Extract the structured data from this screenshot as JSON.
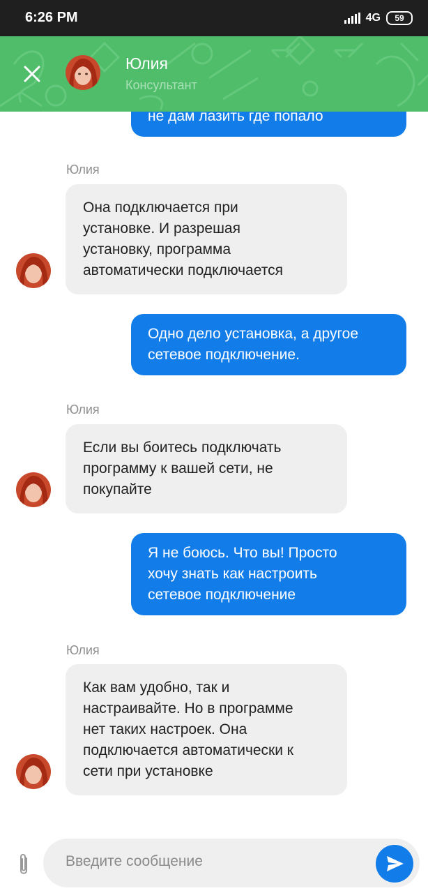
{
  "status_bar": {
    "time": "6:26 PM",
    "network": "4G",
    "battery": "59"
  },
  "header": {
    "name": "Юлия",
    "role": "Консультант",
    "accent_color": "#4fbd6a"
  },
  "messages": [
    {
      "type": "outgoing",
      "lines": [
        "не дам лазить где попало"
      ]
    },
    {
      "type": "incoming",
      "sender": "Юлия",
      "lines": [
        "Она подключается при",
        "установке. И разрешая",
        "установку, программа",
        "автоматически подключается"
      ]
    },
    {
      "type": "outgoing",
      "lines": [
        "Одно дело установка, а другое",
        "сетевое подключение."
      ]
    },
    {
      "type": "incoming",
      "sender": "Юлия",
      "lines": [
        "Если вы боитесь подключать",
        "программу к вашей сети, не",
        "покупайте"
      ]
    },
    {
      "type": "outgoing",
      "lines": [
        "Я не боюсь. Что вы! Просто",
        "хочу знать как настроить",
        "сетевое подключение"
      ]
    },
    {
      "type": "incoming",
      "sender": "Юлия",
      "lines": [
        "Как вам удобно, так и",
        "настраивайте. Но в программе",
        "нет таких настроек. Она",
        "подключается автоматически к",
        "сети при установке"
      ]
    }
  ],
  "composer": {
    "placeholder": "Введите сообщение"
  },
  "colors": {
    "outgoing_bubble": "#127de8",
    "incoming_bubble": "#efefef"
  },
  "icons": {
    "close": "close-icon",
    "attach": "paperclip-icon",
    "send": "send-icon"
  }
}
